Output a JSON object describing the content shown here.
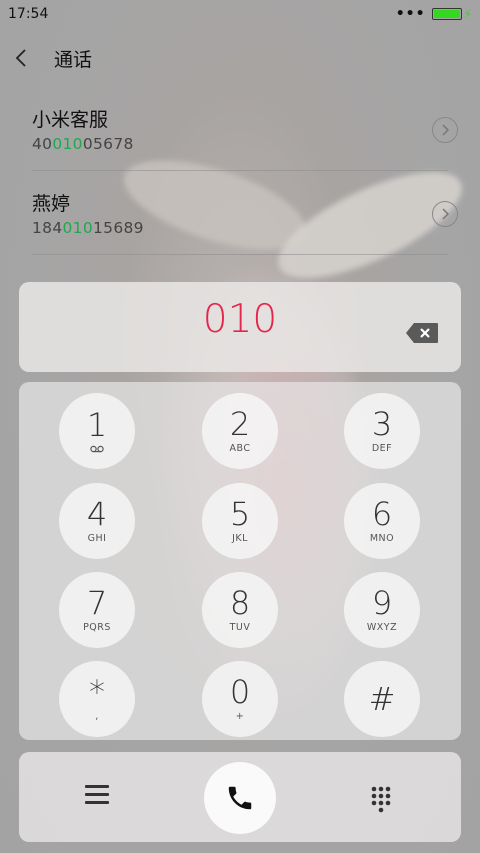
{
  "status_bar": {
    "time": "17:54",
    "signal_dots": "•••",
    "battery_level": 1.0,
    "battery_color": "#33d81f"
  },
  "header": {
    "title": "通话"
  },
  "results": [
    {
      "name": "小米客服",
      "num_pre": "40",
      "num_match": "010",
      "num_post": "05678"
    },
    {
      "name": "燕婷",
      "num_pre": "184",
      "num_match": "010",
      "num_post": "15689"
    }
  ],
  "dialed": "010",
  "keys": [
    {
      "digit": "1",
      "sub": "voicemail-icon"
    },
    {
      "digit": "2",
      "sub": "ABC"
    },
    {
      "digit": "3",
      "sub": "DEF"
    },
    {
      "digit": "4",
      "sub": "GHI"
    },
    {
      "digit": "5",
      "sub": "JKL"
    },
    {
      "digit": "6",
      "sub": "MNO"
    },
    {
      "digit": "7",
      "sub": "PQRS"
    },
    {
      "digit": "8",
      "sub": "TUV"
    },
    {
      "digit": "9",
      "sub": "WXYZ"
    },
    {
      "digit": "*",
      "sub": ","
    },
    {
      "digit": "0",
      "sub": "+"
    },
    {
      "digit": "#",
      "sub": ""
    }
  ],
  "colors": {
    "dialed": "#e2264c",
    "match": "#1fa84c"
  }
}
